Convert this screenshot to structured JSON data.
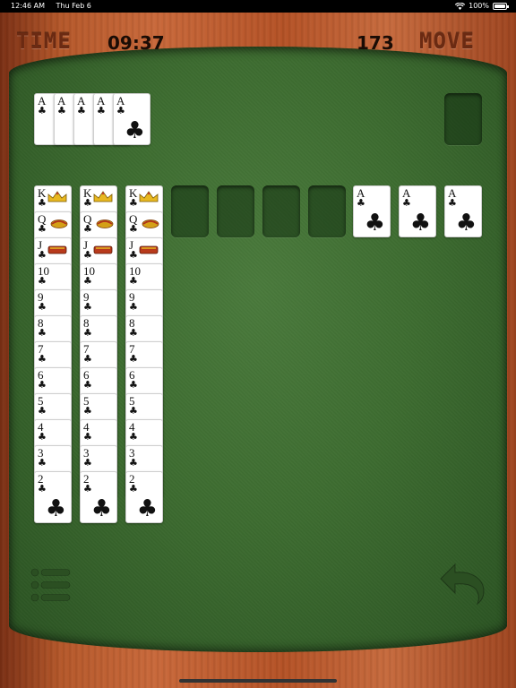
{
  "status": {
    "time": "12:46 AM",
    "date": "Thu Feb 6",
    "battery": "100%"
  },
  "header": {
    "time_label": "TIME",
    "time_value": "09:37",
    "move_value": "173",
    "move_label": "MOVE"
  },
  "waste": [
    {
      "rank": "A",
      "suit": "♣"
    },
    {
      "rank": "A",
      "suit": "♣"
    },
    {
      "rank": "A",
      "suit": "♣"
    },
    {
      "rank": "A",
      "suit": "♣"
    },
    {
      "rank": "A",
      "suit": "♣"
    }
  ],
  "foundations": [
    {
      "rank": "A",
      "suit": "♣"
    },
    {
      "rank": "A",
      "suit": "♣"
    },
    {
      "rank": "A",
      "suit": "♣"
    }
  ],
  "columns": [
    [
      "K",
      "Q",
      "J",
      "10",
      "9",
      "8",
      "7",
      "6",
      "5",
      "4",
      "3",
      "2"
    ],
    [
      "K",
      "Q",
      "J",
      "10",
      "9",
      "8",
      "7",
      "6",
      "5",
      "4",
      "3",
      "2"
    ],
    [
      "K",
      "Q",
      "J",
      "10",
      "9",
      "8",
      "7",
      "6",
      "5",
      "4",
      "3",
      "2"
    ]
  ],
  "column_suit": "♣",
  "colors": {
    "felt": "#3d6c30",
    "wood": "#b5582a",
    "label": "#6b2a12"
  },
  "icons": {
    "menu": "menu-list-icon",
    "undo": "undo-arrow-icon"
  }
}
